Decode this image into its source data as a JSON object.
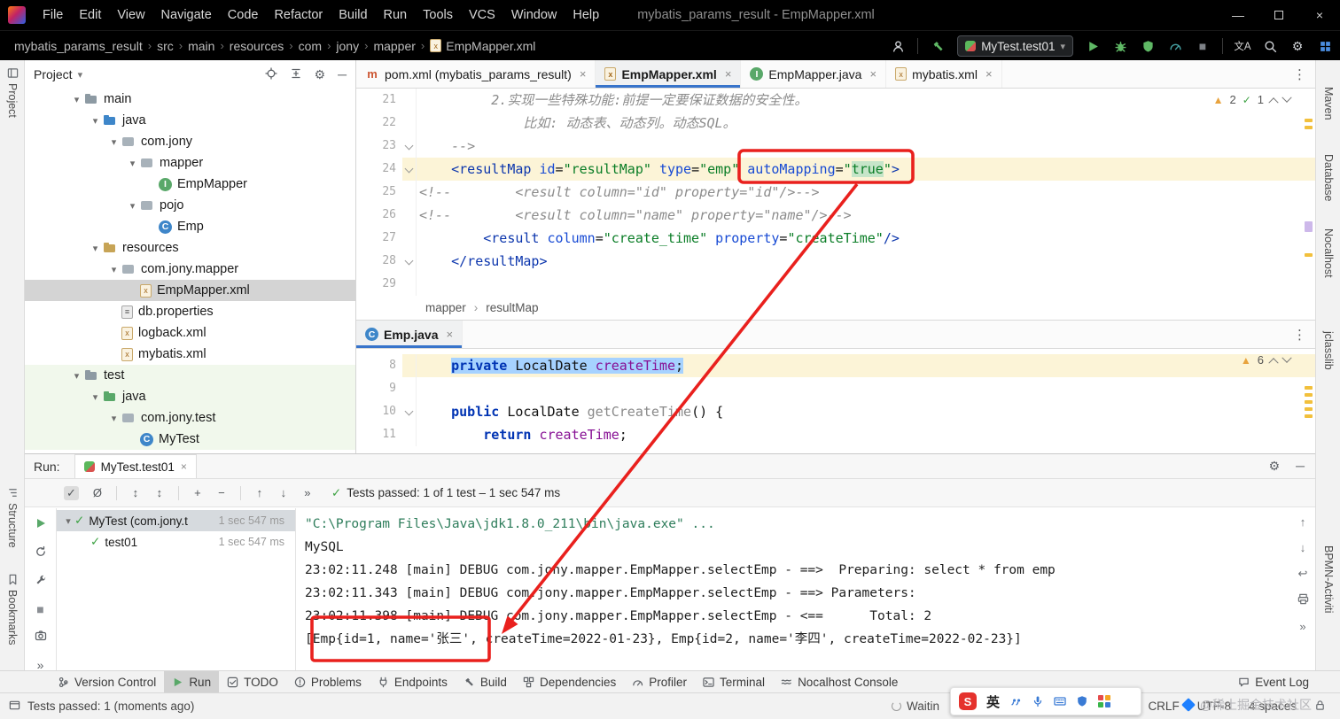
{
  "annotation": {
    "color": "#e9201d"
  },
  "titlebar": {
    "menus": [
      "File",
      "Edit",
      "View",
      "Navigate",
      "Code",
      "Refactor",
      "Build",
      "Run",
      "Tools",
      "VCS",
      "Window",
      "Help"
    ],
    "title": "mybatis_params_result - EmpMapper.xml"
  },
  "navbar": {
    "path": [
      "mybatis_params_result",
      "src",
      "main",
      "resources",
      "com",
      "jony",
      "mapper"
    ],
    "file": "EmpMapper.xml",
    "run_config": "MyTest.test01",
    "translate_label": "文A"
  },
  "strips": {
    "left_top": "Project",
    "left_bottom": [
      "Structure",
      "Bookmarks"
    ],
    "right": [
      "Maven",
      "Database",
      "Nocalhost",
      "jclasslib",
      "BPMN-Activiti"
    ]
  },
  "project": {
    "title": "Project",
    "tree": [
      {
        "label": "main",
        "lvl": 2,
        "arrow": true,
        "icon": "folder"
      },
      {
        "label": "java",
        "lvl": 3,
        "arrow": true,
        "icon": "folder-src"
      },
      {
        "label": "com.jony",
        "lvl": 4,
        "arrow": true,
        "icon": "pkg"
      },
      {
        "label": "mapper",
        "lvl": 5,
        "arrow": true,
        "icon": "pkg"
      },
      {
        "label": "EmpMapper",
        "lvl": 6,
        "icon": "iface"
      },
      {
        "label": "pojo",
        "lvl": 5,
        "arrow": true,
        "icon": "pkg"
      },
      {
        "label": "Emp",
        "lvl": 6,
        "icon": "cls"
      },
      {
        "label": "resources",
        "lvl": 3,
        "arrow": true,
        "icon": "folder-res"
      },
      {
        "label": "com.jony.mapper",
        "lvl": 4,
        "arrow": true,
        "icon": "pkg"
      },
      {
        "label": "EmpMapper.xml",
        "lvl": 5,
        "icon": "xml",
        "selected": true
      },
      {
        "label": "db.properties",
        "lvl": 4,
        "icon": "props"
      },
      {
        "label": "logback.xml",
        "lvl": 4,
        "icon": "xml"
      },
      {
        "label": "mybatis.xml",
        "lvl": 4,
        "icon": "xml"
      },
      {
        "label": "test",
        "lvl": 2,
        "arrow": true,
        "icon": "folder",
        "zone": "test"
      },
      {
        "label": "java",
        "lvl": 3,
        "arrow": true,
        "icon": "folder-test",
        "zone": "test"
      },
      {
        "label": "com.jony.test",
        "lvl": 4,
        "arrow": true,
        "icon": "pkg",
        "zone": "test"
      },
      {
        "label": "MyTest",
        "lvl": 5,
        "icon": "cls",
        "zone": "test"
      }
    ]
  },
  "tabs1": [
    {
      "label": "pom.xml (mybatis_params_result)",
      "icon": "maven"
    },
    {
      "label": "EmpMapper.xml",
      "icon": "xml",
      "active": true
    },
    {
      "label": "EmpMapper.java",
      "icon": "iface"
    },
    {
      "label": "mybatis.xml",
      "icon": "xml"
    }
  ],
  "tabs2": [
    {
      "label": "Emp.java",
      "icon": "cls",
      "active": true
    }
  ],
  "editor1": {
    "widget_warn": "2",
    "widget_ok": "1",
    "lines": [
      {
        "n": 21,
        "segs": [
          [
            "         2.实现一些特殊功能:前提一定要保证数据的安全性。",
            "comment"
          ]
        ]
      },
      {
        "n": 22,
        "segs": [
          [
            "             比如: 动态表、动态列。动态SQL。",
            "comment"
          ]
        ]
      },
      {
        "n": 23,
        "fold": true,
        "segs": [
          [
            "    -->",
            "comment"
          ]
        ]
      },
      {
        "n": 24,
        "cur": true,
        "fold": true,
        "segs": [
          [
            "    ",
            "plain"
          ],
          [
            "<",
            "tag"
          ],
          [
            "resultMap",
            "tag"
          ],
          [
            " ",
            "plain"
          ],
          [
            "id",
            "attr"
          ],
          [
            "=",
            "plain"
          ],
          [
            "\"resultMap\"",
            "str"
          ],
          [
            " ",
            "plain"
          ],
          [
            "type",
            "attr"
          ],
          [
            "=",
            "plain"
          ],
          [
            "\"emp\"",
            "str"
          ],
          [
            " ",
            "plain"
          ],
          [
            "autoMapping",
            "attr"
          ],
          [
            "=",
            "plain"
          ],
          [
            "\"",
            "str"
          ],
          [
            "true",
            "str sel2"
          ],
          [
            "\"",
            "str"
          ],
          [
            ">",
            "tag"
          ]
        ]
      },
      {
        "n": 25,
        "segs": [
          [
            "<!--        <result column=\"id\" property=\"id\"/>-->",
            "comment"
          ]
        ]
      },
      {
        "n": 26,
        "segs": [
          [
            "<!--        <result column=\"name\" property=\"name\"/>-->",
            "comment"
          ]
        ]
      },
      {
        "n": 27,
        "segs": [
          [
            "        ",
            "plain"
          ],
          [
            "<",
            "tag"
          ],
          [
            "result",
            "tag"
          ],
          [
            " ",
            "plain"
          ],
          [
            "column",
            "attr"
          ],
          [
            "=",
            "plain"
          ],
          [
            "\"create_time\"",
            "str"
          ],
          [
            " ",
            "plain"
          ],
          [
            "property",
            "attr"
          ],
          [
            "=",
            "plain"
          ],
          [
            "\"createTime\"",
            "str"
          ],
          [
            "/>",
            "tag"
          ]
        ]
      },
      {
        "n": 28,
        "fold": true,
        "segs": [
          [
            "    ",
            "plain"
          ],
          [
            "</resultMap>",
            "tag"
          ]
        ]
      },
      {
        "n": 29,
        "segs": []
      }
    ]
  },
  "crumb2": [
    "mapper",
    "resultMap"
  ],
  "editor2": {
    "widget_warn": "6",
    "lines": [
      {
        "n": 8,
        "cur": true,
        "segs": [
          [
            "    ",
            "plain"
          ],
          [
            "private",
            "kw sel"
          ],
          [
            " ",
            "plain sel"
          ],
          [
            "LocalDate",
            "plain sel"
          ],
          [
            " ",
            "plain sel"
          ],
          [
            "createTime",
            "field sel"
          ],
          [
            ";",
            "plain sel"
          ]
        ]
      },
      {
        "n": 9,
        "segs": []
      },
      {
        "n": 10,
        "fold": true,
        "segs": [
          [
            "    ",
            "plain"
          ],
          [
            "public",
            "kw"
          ],
          [
            " ",
            "plain"
          ],
          [
            "LocalDate",
            "plain"
          ],
          [
            " ",
            "plain"
          ],
          [
            "getCreateTime",
            "meth"
          ],
          [
            "() {",
            "plain"
          ]
        ]
      },
      {
        "n": 11,
        "segs": [
          [
            "        ",
            "plain"
          ],
          [
            "return",
            "kw"
          ],
          [
            " ",
            "plain"
          ],
          [
            "createTime",
            "field"
          ],
          [
            ";",
            "plain"
          ]
        ]
      }
    ]
  },
  "run": {
    "label": "Run:",
    "tab": "MyTest.test01",
    "status": "Tests passed: 1 of 1 test – 1 sec 547 ms",
    "toolbar_icons": [
      {
        "g": "✓",
        "name": "show-passed-toggle",
        "boxed": true
      },
      {
        "g": "Ø",
        "name": "show-ignored-toggle"
      },
      {
        "g": "|",
        "name": "separator",
        "sep": true
      },
      {
        "g": "↕",
        "name": "sort-alphabetically-toggle"
      },
      {
        "g": "↕",
        "name": "sort-by-duration-toggle"
      },
      {
        "g": "|",
        "name": "separator",
        "sep": true
      },
      {
        "g": "+",
        "name": "expand-all-button"
      },
      {
        "g": "−",
        "name": "collapse-all-button"
      },
      {
        "g": "|",
        "name": "separator",
        "sep": true
      },
      {
        "g": "↑",
        "name": "previous-failed-test-button"
      },
      {
        "g": "↓",
        "name": "next-failed-test-button"
      },
      {
        "g": "»",
        "name": "more-options-chevrons"
      }
    ],
    "left_icons": [
      {
        "icon": "play",
        "name": "rerun-tests-button",
        "color": "#59a869"
      },
      {
        "icon": "refresh",
        "name": "rerun-failed-tests-icon"
      },
      {
        "icon": "wrench",
        "name": "test-settings-icon"
      },
      {
        "icon": "square",
        "name": "stop-button",
        "color": "#8b8f94"
      },
      {
        "icon": "camera",
        "name": "thread-dump-icon"
      },
      {
        "icon": "more",
        "name": "hidden-icons-chevrons"
      }
    ],
    "right_icons": [
      {
        "icon": "up",
        "name": "scroll-to-top-icon"
      },
      {
        "icon": "down",
        "name": "scroll-to-end-icon"
      },
      {
        "icon": "wrap",
        "name": "soft-wrap-icon"
      },
      {
        "icon": "printer",
        "name": "print-console-icon"
      },
      {
        "icon": "more",
        "name": "hidden-icons-chevrons"
      }
    ],
    "tree": [
      {
        "label": "MyTest (com.jony.t",
        "time": "1 sec 547 ms",
        "lvl": 0,
        "arrow": true,
        "selected": true
      },
      {
        "label": "test01",
        "time": "1 sec 547 ms",
        "lvl": 1
      }
    ],
    "console": [
      {
        "t": "\"C:\\Program Files\\Java\\jdk1.8.0_211\\bin\\java.exe\" ...",
        "c": "cmd"
      },
      {
        "t": "MySQL",
        "c": "out"
      },
      {
        "t": "23:02:11.248 [main] DEBUG com.jony.mapper.EmpMapper.selectEmp - ==>  Preparing: select * from emp",
        "c": "out"
      },
      {
        "t": "23:02:11.343 [main] DEBUG com.jony.mapper.EmpMapper.selectEmp - ==> Parameters: ",
        "c": "out"
      },
      {
        "t": "23:02:11.398 [main] DEBUG com.jony.mapper.EmpMapper.selectEmp - <==      Total: 2",
        "c": "out"
      },
      {
        "t": "[Emp{id=1, name='张三', createTime=2022-01-23}, Emp{id=2, name='李四', createTime=2022-02-23}]",
        "c": "out"
      }
    ]
  },
  "toolbuttons": {
    "left": [
      {
        "label": "Version Control",
        "icon": "branch"
      },
      {
        "label": "Run",
        "icon": "play",
        "active": true
      },
      {
        "label": "TODO",
        "icon": "todo"
      },
      {
        "label": "Problems",
        "icon": "problems"
      },
      {
        "label": "Endpoints",
        "icon": "endpoints"
      },
      {
        "label": "Build",
        "icon": "hammer"
      },
      {
        "label": "Dependencies",
        "icon": "deps"
      },
      {
        "label": "Profiler",
        "icon": "profiler"
      },
      {
        "label": "Terminal",
        "icon": "terminal"
      },
      {
        "label": "Nocalhost Console",
        "icon": "waves"
      }
    ],
    "right": [
      {
        "label": "Event Log",
        "icon": "bubble"
      }
    ]
  },
  "statusbar": {
    "left": "Tests passed: 1 (moments ago)",
    "waiting": "Waitin",
    "items": [
      "CRLF",
      "UTF-8",
      "4 spaces"
    ],
    "watermark": "@稀土掘金技术社区",
    "ime_lang": "英"
  }
}
